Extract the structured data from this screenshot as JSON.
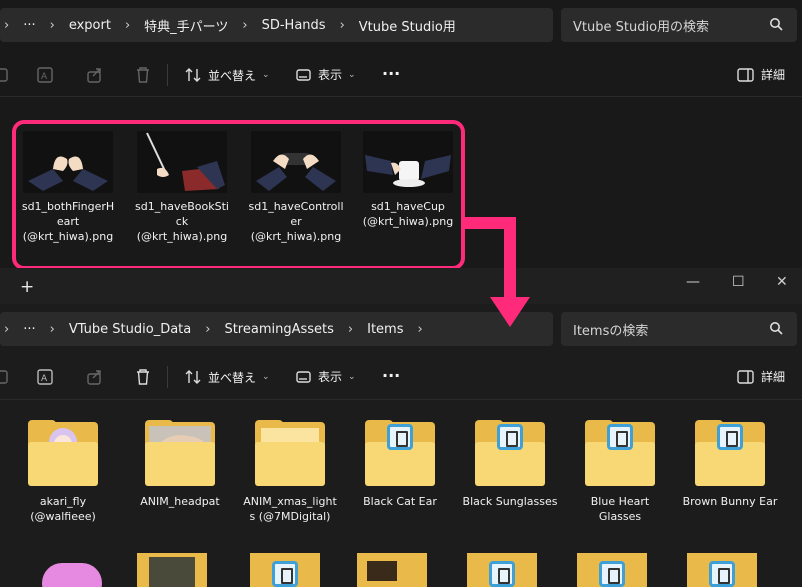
{
  "top_window": {
    "breadcrumbs": [
      "export",
      "特典_手パーツ",
      "SD-Hands",
      "Vtube Studio用"
    ],
    "more_glyph": "···",
    "search_placeholder": "Vtube Studio用の検索",
    "toolbar": {
      "sort_label": "並べ替え",
      "view_label": "表示",
      "more": "···",
      "details_label": "詳細"
    },
    "files": [
      {
        "name_lines": [
          "sd1_bothFingerH",
          "eart",
          "(@krt_hiwa).png"
        ]
      },
      {
        "name_lines": [
          "sd1_haveBookSti",
          "ck",
          "(@krt_hiwa).png"
        ]
      },
      {
        "name_lines": [
          "sd1_haveControll",
          "er",
          "(@krt_hiwa).png"
        ]
      },
      {
        "name_lines": [
          "sd1_haveCup",
          "(@krt_hiwa).png"
        ]
      }
    ]
  },
  "bottom_window": {
    "new_tab": "+",
    "window_controls": {
      "minimize": "—",
      "maximize": "☐",
      "close": "✕"
    },
    "breadcrumbs": [
      "VTube Studio_Data",
      "StreamingAssets",
      "Items"
    ],
    "more_glyph": "···",
    "search_placeholder": "Itemsの検索",
    "toolbar": {
      "sort_label": "並べ替え",
      "view_label": "表示",
      "more": "···",
      "details_label": "詳細"
    },
    "folders": [
      {
        "name_lines": [
          "akari_fly",
          "(@walfieee)"
        ],
        "kind": "photo-girl"
      },
      {
        "name_lines": [
          "ANIM_headpat"
        ],
        "kind": "photo-hand"
      },
      {
        "name_lines": [
          "ANIM_xmas_light",
          "s (@7MDigital)"
        ],
        "kind": "plain"
      },
      {
        "name_lines": [
          "Black Cat Ear"
        ],
        "kind": "vts"
      },
      {
        "name_lines": [
          "Black Sunglasses"
        ],
        "kind": "vts"
      },
      {
        "name_lines": [
          "Blue Heart",
          "Glasses"
        ],
        "kind": "vts"
      },
      {
        "name_lines": [
          "Brown Bunny Ear"
        ],
        "kind": "vts"
      }
    ]
  },
  "colors": {
    "highlight": "#ff2a7a",
    "folder": "#f8d775",
    "background": "#1c1c1c"
  }
}
